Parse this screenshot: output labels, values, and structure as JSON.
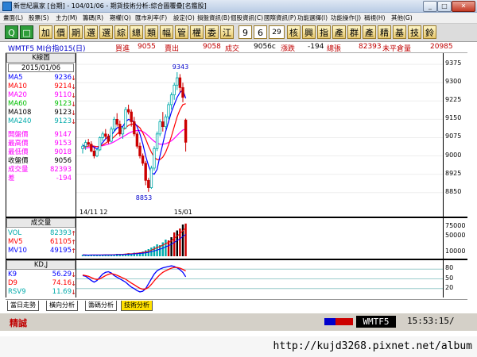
{
  "window": {
    "title": "新世紀贏家 [台期] - 104/01/06 - 期貨技術分析:綜合圖覆疊[名鑑股]",
    "btn_min": "_",
    "btn_max": "□",
    "btn_close": "✕"
  },
  "menu": [
    "畫面(L)",
    "股票(S)",
    "主力(M)",
    "籌碼(R)",
    "期權(Q)",
    "匯市利率(F)",
    "設定(O)",
    "損盤資訊(B)",
    "個股資訊(C)",
    "國際資訊(P)",
    "功能選擇(I)",
    "功能操作(J)",
    "稱視(H)",
    "其他(G)"
  ],
  "toolbar": [
    "Q",
    "□",
    "加",
    "價",
    "期",
    "選",
    "選",
    "綜",
    "總",
    "類",
    "幅",
    "管",
    "權",
    "委",
    "江",
    "9",
    "6",
    "29",
    "核",
    "興",
    "指",
    "產",
    "群",
    "產",
    "精",
    "基",
    "技",
    "鈴"
  ],
  "infoline": {
    "symbol": "WMTF5 MI台指015(日)",
    "bid_label": "買進",
    "bid": "9055",
    "ask_label": "賣出",
    "ask": "9058",
    "last_label": "成交",
    "last": "9056c",
    "chg_label": "漲跌",
    "chg": "-194",
    "vol_label": "總張",
    "vol": "82393",
    "oi_label": "未平倉量",
    "oi": "20985"
  },
  "kpanel": {
    "header": "K線圖",
    "date": "2015/01/06",
    "ma": [
      {
        "name": "MA5",
        "value": "9236",
        "arrow": "↓",
        "color": "#0000ff"
      },
      {
        "name": "MA10",
        "value": "9214",
        "arrow": "↓",
        "color": "#ff0000"
      },
      {
        "name": "MA20",
        "value": "9110",
        "arrow": "↓",
        "color": "#ff00ff"
      },
      {
        "name": "MA60",
        "value": "9123",
        "arrow": "↓",
        "color": "#00c000"
      },
      {
        "name": "MA108",
        "value": "9123",
        "arrow": "↓",
        "color": "#000000"
      },
      {
        "name": "MA240",
        "value": "9123",
        "arrow": "↓",
        "color": "#00aaaa"
      }
    ],
    "prices": [
      {
        "name": "開盤價",
        "value": "9147",
        "color": "#ff00ff"
      },
      {
        "name": "最高價",
        "value": "9153",
        "color": "#ff00ff"
      },
      {
        "name": "最低價",
        "value": "9018",
        "color": "#ff00ff"
      },
      {
        "name": "收盤價",
        "value": "9056",
        "color": "#000000"
      },
      {
        "name": "成交量",
        "value": "82393",
        "color": "#ff00ff"
      },
      {
        "name": "差",
        "value": "-194",
        "color": "#ff00ff"
      }
    ]
  },
  "vpanel": {
    "header": "成交量",
    "rows": [
      {
        "name": "VOL",
        "value": "82393",
        "arrow": "↑",
        "color": "#00aaaa"
      },
      {
        "name": "MV5",
        "value": "61105",
        "arrow": "↑",
        "color": "#ff0000"
      },
      {
        "name": "MV10",
        "value": "49195",
        "arrow": "↑",
        "color": "#0000ff"
      }
    ]
  },
  "kdpanel": {
    "header": "KD,J",
    "rows": [
      {
        "name": "K9",
        "value": "56.29",
        "arrow": "↓",
        "color": "#0000ff"
      },
      {
        "name": "D9",
        "value": "74.16",
        "arrow": "↓",
        "color": "#ff0000"
      },
      {
        "name": "RSV9",
        "value": "11.69",
        "arrow": "↓",
        "color": "#00aaaa"
      }
    ]
  },
  "tabs": [
    "當日走勢",
    "橫向分析",
    "籌碼分析",
    "技術分析"
  ],
  "status": {
    "brand": "精誠",
    "symbol": "WMTF5",
    "time": "15:53:15/"
  },
  "watermark": "http://kujd3268.pixnet.net/album",
  "chart_data": [
    {
      "type": "candlestick",
      "ylim": [
        8810,
        9395
      ],
      "yticks": [
        9375,
        9300,
        9225,
        9150,
        9075,
        9000,
        8925,
        8850
      ],
      "x_labels": [
        "14/11",
        "12",
        "15/01"
      ],
      "annotations": {
        "high": "9343",
        "low": "8853"
      },
      "candles": [
        [
          9030,
          9050,
          9010,
          9040
        ],
        [
          9040,
          9065,
          9025,
          9055
        ],
        [
          9055,
          9070,
          9040,
          9048
        ],
        [
          9048,
          9060,
          9015,
          9020
        ],
        [
          9020,
          9035,
          8990,
          9000
        ],
        [
          9000,
          9030,
          8995,
          9025
        ],
        [
          9025,
          9080,
          9020,
          9075
        ],
        [
          9075,
          9100,
          9060,
          9090
        ],
        [
          9090,
          9110,
          9070,
          9080
        ],
        [
          9080,
          9090,
          9050,
          9060
        ],
        [
          9060,
          9120,
          9055,
          9110
        ],
        [
          9110,
          9160,
          9100,
          9150
        ],
        [
          9150,
          9175,
          9120,
          9130
        ],
        [
          9130,
          9145,
          9080,
          9090
        ],
        [
          9090,
          9120,
          9070,
          9115
        ],
        [
          9115,
          9200,
          9110,
          9190
        ],
        [
          9190,
          9210,
          9170,
          9180
        ],
        [
          9180,
          9190,
          9120,
          9140
        ],
        [
          9140,
          9160,
          9080,
          9090
        ],
        [
          9090,
          9100,
          9030,
          9040
        ],
        [
          9040,
          9055,
          8990,
          9000
        ],
        [
          9000,
          9010,
          8960,
          8970
        ],
        [
          8970,
          8980,
          8880,
          8900
        ],
        [
          8900,
          8910,
          8853,
          8870
        ],
        [
          8870,
          8960,
          8865,
          8950
        ],
        [
          8950,
          9040,
          8940,
          9030
        ],
        [
          9030,
          9100,
          9020,
          9090
        ],
        [
          9090,
          9150,
          9080,
          9140
        ],
        [
          9140,
          9180,
          9100,
          9120
        ],
        [
          9120,
          9170,
          9110,
          9160
        ],
        [
          9160,
          9220,
          9150,
          9210
        ],
        [
          9210,
          9260,
          9190,
          9250
        ],
        [
          9250,
          9300,
          9230,
          9290
        ],
        [
          9290,
          9343,
          9270,
          9320
        ],
        [
          9320,
          9335,
          9260,
          9280
        ],
        [
          9280,
          9300,
          9220,
          9240
        ],
        [
          9147,
          9153,
          9018,
          9056
        ]
      ],
      "ma5": [
        9040,
        9045,
        9050,
        9045,
        9035,
        9028,
        9040,
        9055,
        9070,
        9080,
        9085,
        9100,
        9115,
        9118,
        9120,
        9140,
        9150,
        9145,
        9140,
        9120,
        9090,
        9050,
        9000,
        8960,
        8930,
        8925,
        8945,
        9000,
        9050,
        9100,
        9140,
        9180,
        9210,
        9240,
        9260,
        9270,
        9236
      ],
      "ma10": [
        9035,
        9038,
        9040,
        9042,
        9040,
        9038,
        9040,
        9045,
        9052,
        9060,
        9068,
        9078,
        9090,
        9100,
        9105,
        9115,
        9125,
        9130,
        9130,
        9125,
        9115,
        9095,
        9070,
        9040,
        9015,
        8995,
        8985,
        8985,
        8995,
        9015,
        9045,
        9080,
        9120,
        9160,
        9190,
        9210,
        9214
      ],
      "ma20": [
        9030,
        9032,
        9034,
        9036,
        9037,
        9038,
        9040,
        9042,
        9045,
        9048,
        9052,
        9058,
        9065,
        9072,
        9078,
        9085,
        9092,
        9098,
        9102,
        9104,
        9104,
        9100,
        9092,
        9082,
        9070,
        9060,
        9052,
        9048,
        9048,
        9050,
        9055,
        9062,
        9072,
        9084,
        9096,
        9106,
        9110
      ]
    },
    {
      "type": "bar",
      "ylim": [
        0,
        90000
      ],
      "yticks": [
        75000,
        50000,
        10000
      ],
      "values": [
        3500,
        3000,
        2500,
        4000,
        3200,
        2800,
        3600,
        3000,
        4500,
        4200,
        3800,
        4800,
        6000,
        5200,
        4800,
        6500,
        8000,
        7000,
        9000,
        8500,
        10000,
        12000,
        15000,
        18000,
        22000,
        25000,
        30000,
        28000,
        35000,
        42000,
        40000,
        48000,
        60000,
        65000,
        70000,
        80000,
        82393
      ]
    },
    {
      "type": "line",
      "ylim": [
        0,
        100
      ],
      "yticks": [
        80,
        50,
        20
      ],
      "series": [
        {
          "name": "K9",
          "values": [
            60,
            58,
            52,
            45,
            40,
            45,
            55,
            65,
            70,
            72,
            68,
            60,
            55,
            50,
            45,
            40,
            32,
            25,
            20,
            14,
            10,
            12,
            20,
            35,
            50,
            65,
            75,
            80,
            84,
            86,
            88,
            90,
            88,
            84,
            78,
            70,
            56.29
          ]
        },
        {
          "name": "D9",
          "values": [
            62,
            60,
            58,
            54,
            50,
            48,
            50,
            55,
            60,
            64,
            66,
            64,
            61,
            57,
            53,
            49,
            43,
            37,
            32,
            26,
            21,
            18,
            19,
            24,
            33,
            44,
            54,
            63,
            70,
            75,
            79,
            83,
            85,
            85,
            83,
            79,
            74.16
          ]
        }
      ]
    }
  ]
}
